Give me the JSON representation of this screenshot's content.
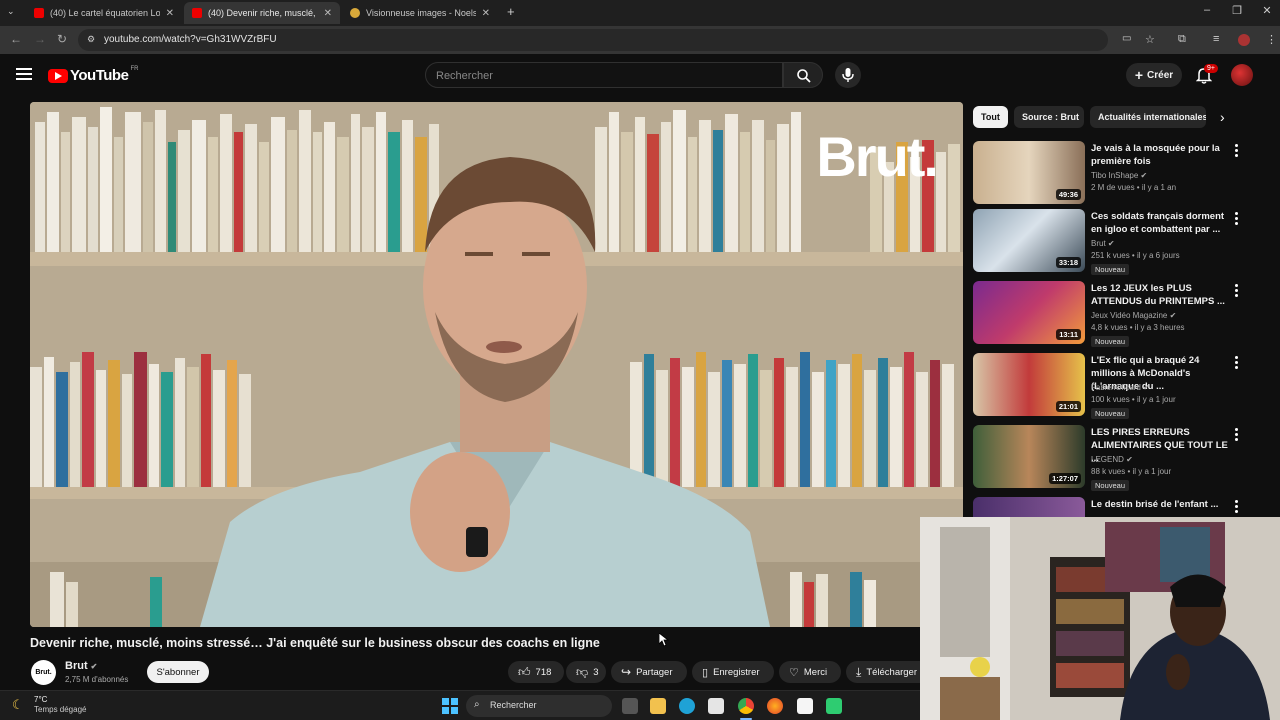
{
  "browser": {
    "tabs": [
      {
        "title": "(40) Le cartel équatorien Los Lo",
        "active": false
      },
      {
        "title": "(40) Devenir riche, musclé, ",
        "active": true
      },
      {
        "title": "Visionneuse images - Noelsha",
        "active": false
      }
    ],
    "url": "youtube.com/watch?v=Gh31WVZrBFU"
  },
  "youtube": {
    "logo_text": "YouTube",
    "country": "FR",
    "search_placeholder": "Rechercher",
    "create_label": "Créer",
    "notifications": "9+"
  },
  "video": {
    "overlay_brand": "Brut.",
    "title": "Devenir riche, musclé, moins stressé… J'ai enquêté sur le business obscur des coachs en ligne",
    "channel": "Brut",
    "channel_avatar_text": "Brut.",
    "subscribers": "2,75 M d'abonnés",
    "subscribe_label": "S'abonner",
    "likes": "718",
    "dislikes": "3",
    "share_label": "Partager",
    "save_label": "Enregistrer",
    "thanks_label": "Merci",
    "download_label": "Télécharger"
  },
  "sidebar": {
    "chips": [
      "Tout",
      "Source : Brut",
      "Actualités internationales"
    ],
    "recommendations": [
      {
        "title": "Je vais à la mosquée pour la première fois",
        "channel": "Tibo InShape",
        "meta": "2 M de vues • il y a 1 an",
        "duration": "49:36",
        "new": ""
      },
      {
        "title": "Ces soldats français dorment en igloo et combattent par ...",
        "channel": "Brut",
        "meta": "251 k vues • il y a 6 jours",
        "duration": "33:18",
        "new": "Nouveau"
      },
      {
        "title": "Les 12 JEUX les PLUS ATTENDUS du PRINTEMPS ...",
        "channel": "Jeux Vidéo Magazine",
        "meta": "4,8 k vues • il y a 3 heures",
        "duration": "13:11",
        "new": "Nouveau"
      },
      {
        "title": "L'Ex flic qui a braqué 24 millions à McDonald's (L'arnaque du ...",
        "channel": "FabienOlicard",
        "meta": "100 k vues • il y a 1 jour",
        "duration": "21:01",
        "new": "Nouveau"
      },
      {
        "title": "LES PIRES ERREURS ALIMENTAIRES QUE TOUT LE ...",
        "channel": "LEGEND",
        "meta": "88 k vues • il y a 1 jour",
        "duration": "1:27:07",
        "new": "Nouveau"
      },
      {
        "title": "Le destin brisé de l'enfant ...",
        "channel": "",
        "meta": "",
        "duration": "",
        "new": ""
      }
    ]
  },
  "taskbar": {
    "temperature": "7°C",
    "weather": "Temps dégagé",
    "search_label": "Rechercher"
  }
}
